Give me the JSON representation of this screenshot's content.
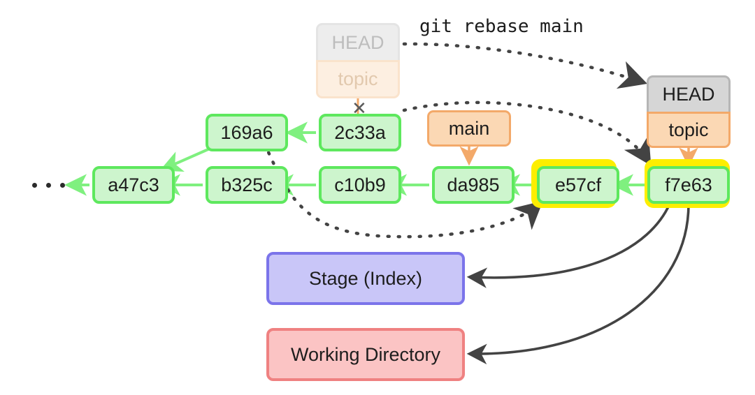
{
  "diagram": {
    "title": "git rebase main",
    "command_caption": "git rebase main",
    "ellipsis": "· · ·",
    "drop_marker": "✕"
  },
  "colors": {
    "commit_border": "#5ee85e",
    "commit_fill": "#cdf5cd",
    "highlight_glow": "#fdee00",
    "ref_border": "#f3a969",
    "ref_fill": "#fbd8b4",
    "head_border": "#b6b6b6",
    "head_fill": "#d6d6d6",
    "stage_border": "#7b74ea",
    "stage_fill": "#c9c6f8",
    "working_border": "#ef8181",
    "working_fill": "#fbc4c4",
    "edge_dark": "#434343",
    "edge_green": "#7ff07f",
    "edge_orange": "#f3a969",
    "faded_text": "#bdbdbd"
  },
  "commits": [
    {
      "id": "a47c3",
      "label": "a47c3",
      "highlighted": false
    },
    {
      "id": "b325c",
      "label": "b325c",
      "highlighted": false
    },
    {
      "id": "c10b9",
      "label": "c10b9",
      "highlighted": false
    },
    {
      "id": "da985",
      "label": "da985",
      "highlighted": false
    },
    {
      "id": "e57cf",
      "label": "e57cf",
      "highlighted": true
    },
    {
      "id": "f7e63",
      "label": "f7e63",
      "highlighted": true
    },
    {
      "id": "169a6",
      "label": "169a6",
      "highlighted": false
    },
    {
      "id": "2c33a",
      "label": "2c33a",
      "highlighted": false
    }
  ],
  "refs": {
    "main": "main",
    "head_new": "HEAD",
    "topic_new": "topic",
    "head_old": "HEAD",
    "topic_old": "topic"
  },
  "areas": {
    "stage": "Stage (Index)",
    "working": "Working Directory"
  }
}
